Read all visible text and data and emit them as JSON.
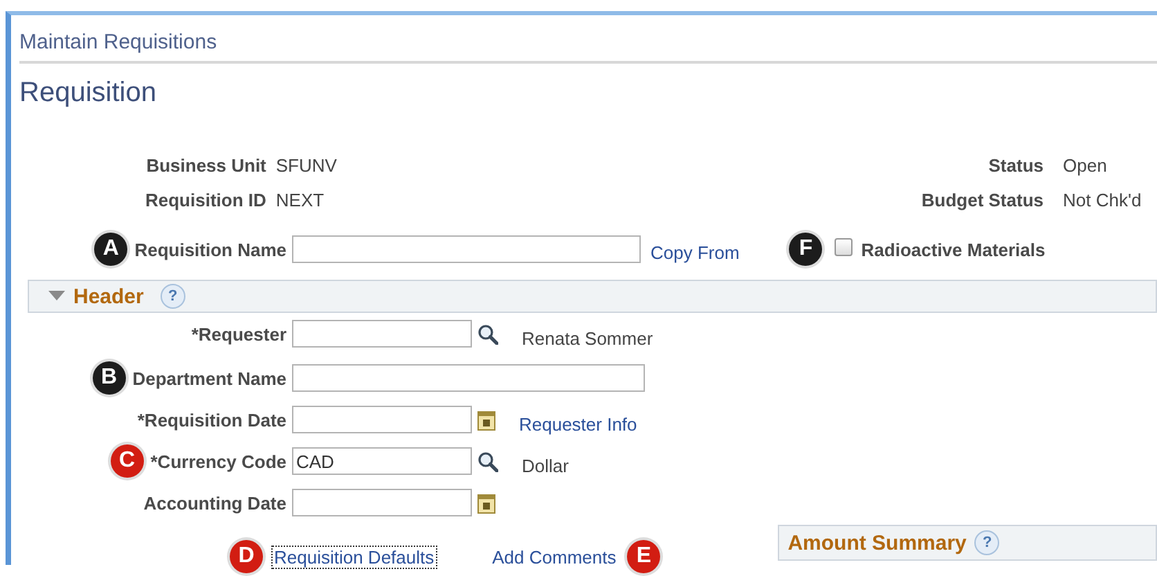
{
  "page_title": "Maintain Requisitions",
  "heading": "Requisition",
  "info_left": [
    {
      "label": "Business Unit",
      "value": "SFUNV"
    },
    {
      "label": "Requisition ID",
      "value": "NEXT"
    }
  ],
  "info_right": [
    {
      "label": "Status",
      "value": "Open"
    },
    {
      "label": "Budget Status",
      "value": "Not Chk'd"
    }
  ],
  "name_row": {
    "callout": {
      "letter": "A",
      "color": "#1c1c1c"
    },
    "label": "Requisition Name",
    "link": "Copy From"
  },
  "radioactive": {
    "callout": {
      "letter": "F",
      "color": "#1c1c1c"
    },
    "label": "Radioactive Materials",
    "checked": false
  },
  "header_section": {
    "title": "Header",
    "expanded": true,
    "help": "?"
  },
  "fields": [
    {
      "kind": "lookup",
      "label": "*Requester",
      "side": {
        "kind": "text",
        "text": "Renata Sommer"
      }
    },
    {
      "kind": "wide",
      "label": "Department Name",
      "callout": {
        "letter": "B",
        "color": "#1c1c1c"
      }
    },
    {
      "kind": "date",
      "label": "*Requisition Date",
      "side": {
        "kind": "link",
        "text": "Requester Info"
      }
    },
    {
      "kind": "lookup",
      "label": "*Currency Code",
      "value": "CAD",
      "callout": {
        "letter": "C",
        "color": "#d21d12"
      },
      "side": {
        "kind": "text",
        "text": "Dollar"
      }
    },
    {
      "kind": "date",
      "label": "Accounting Date"
    }
  ],
  "links": [
    {
      "text": "Requisition Defaults",
      "focused": true,
      "callout": {
        "letter": "D",
        "color": "#d21d12"
      },
      "callout_after": false
    },
    {
      "text": "Add Comments",
      "focused": false,
      "callout": {
        "letter": "E",
        "color": "#d21d12"
      },
      "callout_after": true
    }
  ],
  "amount_summary": {
    "title": "Amount Summary",
    "help": "?"
  }
}
